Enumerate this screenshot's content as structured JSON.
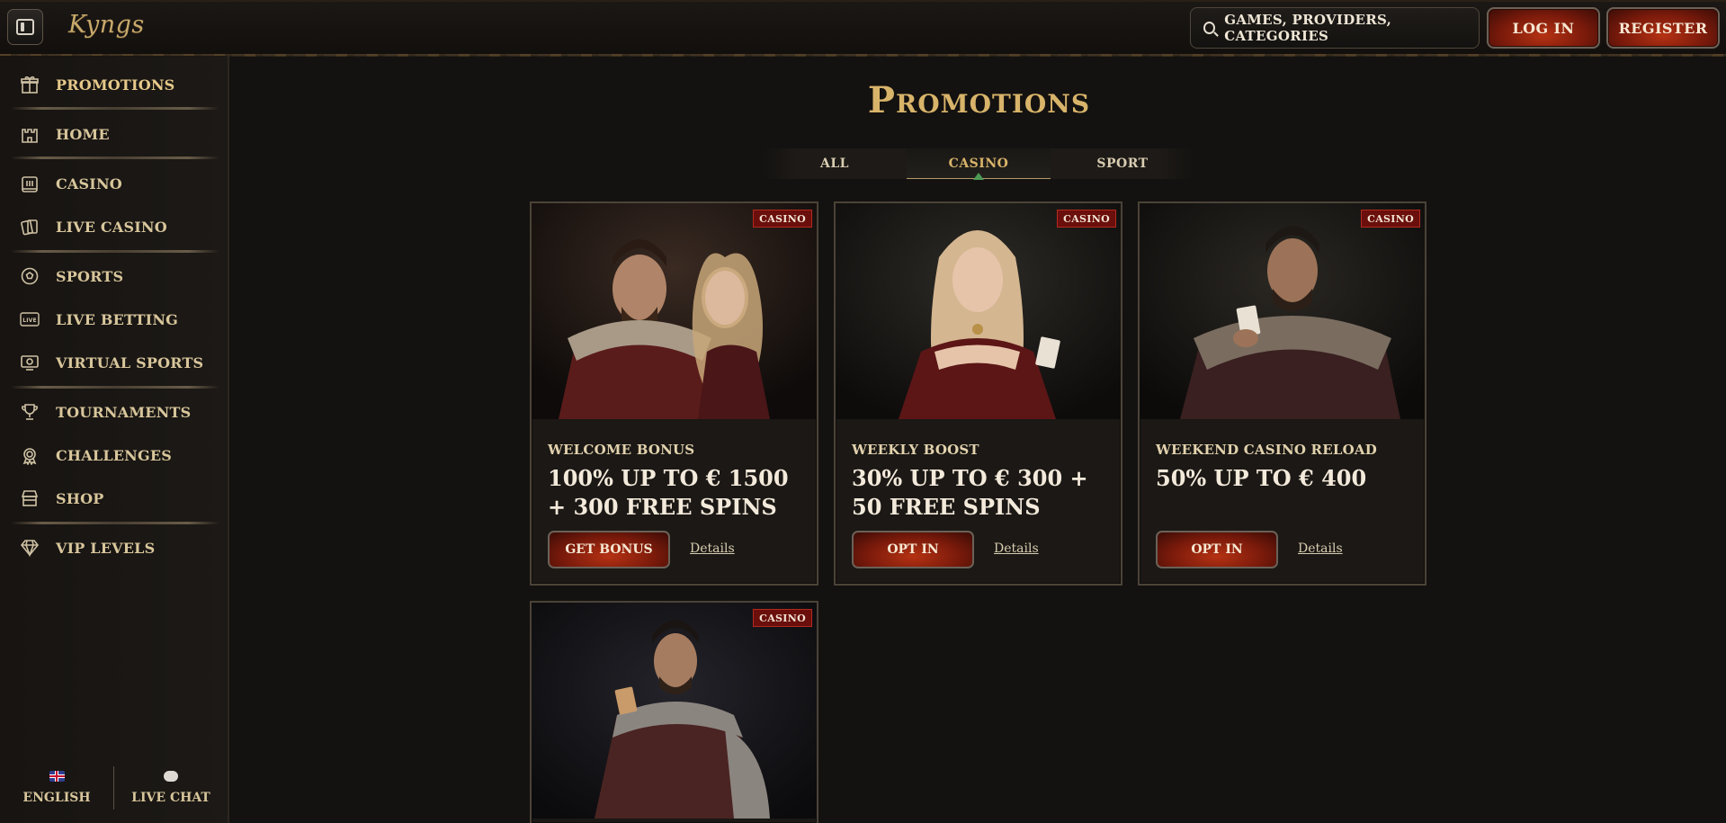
{
  "header": {
    "logo": "Kyngs",
    "search_placeholder": "GAMES, PROVIDERS, CATEGORIES",
    "login_label": "LOG IN",
    "register_label": "REGISTER"
  },
  "sidebar": {
    "items": [
      {
        "label": "PROMOTIONS",
        "icon": "gift-icon",
        "active": true
      },
      {
        "label": "HOME",
        "icon": "castle-icon"
      },
      {
        "label": "CASINO",
        "icon": "slot-machine-icon"
      },
      {
        "label": "LIVE CASINO",
        "icon": "cards-icon"
      },
      {
        "label": "SPORTS",
        "icon": "soccer-ball-icon"
      },
      {
        "label": "LIVE BETTING",
        "icon": "live-icon"
      },
      {
        "label": "VIRTUAL SPORTS",
        "icon": "monitor-icon"
      },
      {
        "label": "TOURNAMENTS",
        "icon": "trophy-icon"
      },
      {
        "label": "CHALLENGES",
        "icon": "badge-icon"
      },
      {
        "label": "SHOP",
        "icon": "shop-icon"
      },
      {
        "label": "VIP LEVELS",
        "icon": "diamond-icon"
      }
    ],
    "language_label": "ENGLISH",
    "chat_label": "LIVE CHAT"
  },
  "main": {
    "title": "Promotions",
    "tabs": [
      {
        "label": "ALL"
      },
      {
        "label": "CASINO",
        "active": true
      },
      {
        "label": "SPORT"
      }
    ],
    "cards": [
      {
        "badge": "CASINO",
        "subtitle": "WELCOME BONUS",
        "headline": "100% UP TO € 1500 + 300 FREE SPINS",
        "cta": "GET BONUS",
        "details": "Details"
      },
      {
        "badge": "CASINO",
        "subtitle": "WEEKLY BOOST",
        "headline": "30% UP TO € 300 + 50 FREE SPINS",
        "cta": "OPT IN",
        "details": "Details"
      },
      {
        "badge": "CASINO",
        "subtitle": "WEEKEND CASINO RELOAD",
        "headline": "50% UP TO € 400",
        "cta": "OPT IN",
        "details": "Details"
      },
      {
        "badge": "CASINO"
      }
    ]
  },
  "colors": {
    "background": "#141210",
    "gold": "#d8b46a",
    "button_red": "#7a1a0b",
    "badge_red": "#6a0f0c"
  }
}
